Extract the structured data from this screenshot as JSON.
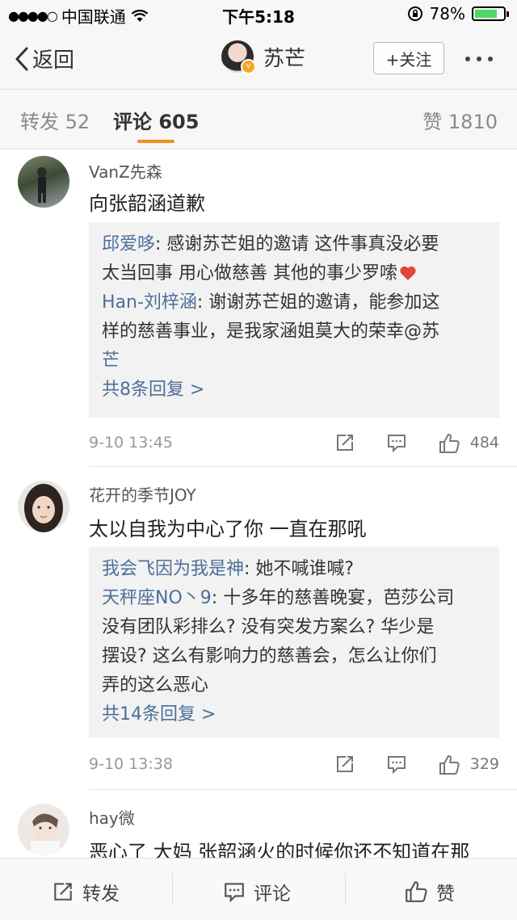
{
  "status_bar": {
    "carrier": "中国联通",
    "time": "下午5:18",
    "battery": "78%",
    "battery_level": 0.78
  },
  "nav": {
    "back_label": "返回",
    "user_name": "苏芒",
    "follow_label": "+关注"
  },
  "tabs": {
    "repost": "转发 52",
    "comment": "评论 605",
    "like": "赞 1810"
  },
  "comments": [
    {
      "user": "VanZ先森",
      "text": "向张韶涵道歉",
      "replies": [
        {
          "name": "邱爱哆",
          "lines": [
            "感谢苏芒姐的邀请 这件事真没必要",
            "太当回事 用心做慈善 其他的事少罗嗦"
          ]
        },
        {
          "name": "Han-刘梓涵",
          "lines": [
            "谢谢苏芒姐的邀请，能参加这",
            "样的慈善事业，是我家涵姐莫大的荣幸@苏",
            "芒"
          ]
        }
      ],
      "more_replies": "共8条回复 >",
      "time": "9-10 13:45",
      "likes": "484"
    },
    {
      "user": "花开的季节JOY",
      "text": "太以自我为中心了你 一直在那吼",
      "replies": [
        {
          "name": "我会飞因为我是神",
          "lines": [
            "她不喊谁喊?"
          ]
        },
        {
          "name": "天秤座NO丶9",
          "lines": [
            "十多年的慈善晚宴，芭莎公司",
            "没有团队彩排么? 没有突发方案么? 华少是",
            "摆设? 这么有影响力的慈善会，怎么让你们",
            "弄的这么恶心"
          ]
        }
      ],
      "more_replies": "共14条回复 >",
      "time": "9-10 13:38",
      "likes": "329"
    },
    {
      "user": "hay微",
      "text": "恶心了 大妈 张韶涵火的时候你还不知道在那"
    }
  ],
  "bottom_bar": {
    "repost": "转发",
    "comment": "评论",
    "like": "赞"
  },
  "colors": {
    "accent": "#f28e1e",
    "link": "#4c6f9a",
    "heart": "#e0463a"
  }
}
